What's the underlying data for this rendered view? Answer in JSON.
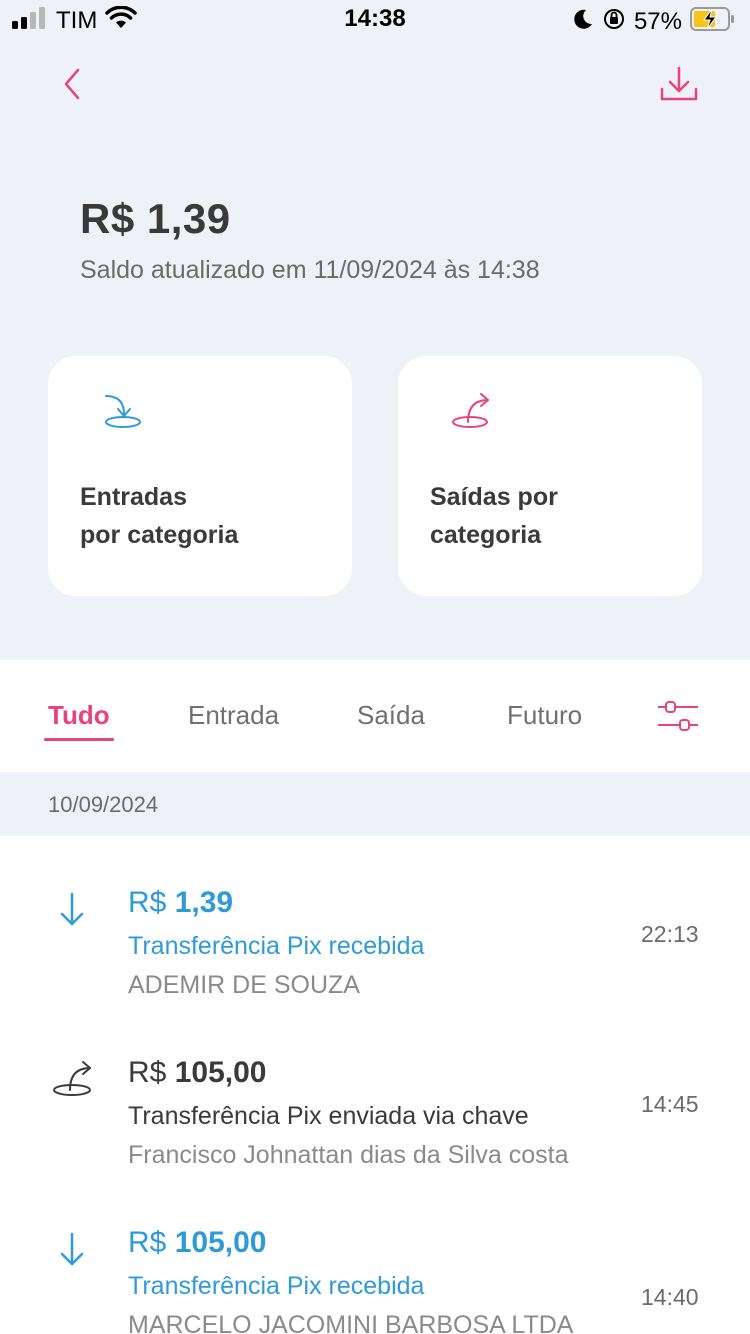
{
  "status_bar": {
    "carrier": "TIM",
    "time": "14:38",
    "battery": "57%",
    "icons": [
      "signal-icon",
      "wifi-icon",
      "moon-icon",
      "orientation-lock-icon",
      "battery-charging-icon"
    ]
  },
  "colors": {
    "accent": "#e8437a",
    "incoming": "#2f9bd6",
    "background": "#eef2f7",
    "text_primary": "#3a3a3a",
    "text_secondary": "#6b6b6b"
  },
  "header": {
    "back_icon": "chevron-left-icon",
    "download_icon": "download-icon"
  },
  "balance": {
    "amount": "R$ 1,39",
    "updated": "Saldo atualizado em 11/09/2024 às 14:38"
  },
  "cards": [
    {
      "label": "Entradas\npor categoria",
      "icon": "incoming-arrow-icon"
    },
    {
      "label": "Saídas por\ncategoria",
      "icon": "outgoing-arrow-icon"
    }
  ],
  "tabs": [
    {
      "label": "Tudo",
      "active": true
    },
    {
      "label": "Entrada",
      "active": false
    },
    {
      "label": "Saída",
      "active": false
    },
    {
      "label": "Futuro",
      "active": false
    }
  ],
  "filter_icon": "filter-sliders-icon",
  "date_group": "10/09/2024",
  "transactions": [
    {
      "direction": "in",
      "currency": "R$",
      "amount": "1,39",
      "description": "Transferência Pix recebida",
      "name": "ADEMIR DE SOUZA",
      "time": "22:13"
    },
    {
      "direction": "out",
      "currency": "R$",
      "amount": "105,00",
      "description": "Transferência Pix enviada via chave",
      "name": "Francisco Johnattan dias da Silva costa",
      "time": "14:45"
    },
    {
      "direction": "in",
      "currency": "R$",
      "amount": "105,00",
      "description": "Transferência Pix recebida",
      "name": "MARCELO JACOMINI BARBOSA LTDA",
      "time": "14:40"
    }
  ]
}
